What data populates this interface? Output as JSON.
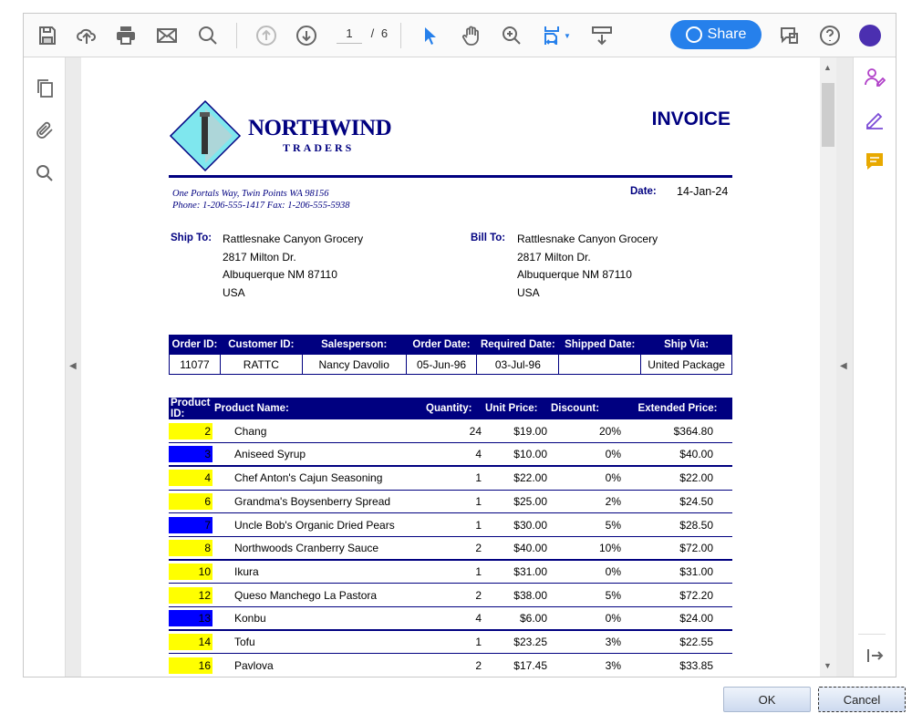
{
  "toolbar": {
    "page_current": "1",
    "page_sep": "/",
    "page_total": "6",
    "share_label": "Share"
  },
  "invoice": {
    "company_line1": "NORTHWIND",
    "company_line2": "TRADERS",
    "title": "INVOICE",
    "address": "One Portals Way, Twin Points WA  98156",
    "phone": "Phone: 1-206-555-1417   Fax: 1-206-555-5938",
    "date_label": "Date:",
    "date_value": "14-Jan-24",
    "ship_to_label": "Ship To:",
    "bill_to_label": "Bill To:",
    "ship_to": [
      "Rattlesnake Canyon Grocery",
      "2817 Milton Dr.",
      "Albuquerque NM  87110",
      "USA"
    ],
    "bill_to": [
      "Rattlesnake Canyon Grocery",
      "2817 Milton Dr.",
      "Albuquerque NM  87110",
      "USA"
    ],
    "order_headers": [
      "Order ID:",
      "Customer ID:",
      "Salesperson:",
      "Order Date:",
      "Required Date:",
      "Shipped Date:",
      "Ship Via:"
    ],
    "order_values": [
      "11077",
      "RATTC",
      "Nancy Davolio",
      "05-Jun-96",
      "03-Jul-96",
      "",
      "United Package"
    ],
    "product_headers": [
      "Product ID:",
      "Product Name:",
      "Quantity:",
      "Unit Price:",
      "Discount:",
      "Extended Price:"
    ],
    "products": [
      {
        "id": "2",
        "name": "Chang",
        "qty": "24",
        "price": "$19.00",
        "disc": "20%",
        "ext": "$364.80",
        "hl": "yellow"
      },
      {
        "id": "3",
        "name": "Aniseed Syrup",
        "qty": "4",
        "price": "$10.00",
        "disc": "0%",
        "ext": "$40.00",
        "hl": "blue"
      },
      {
        "id": "4",
        "name": "Chef Anton's Cajun Seasoning",
        "qty": "1",
        "price": "$22.00",
        "disc": "0%",
        "ext": "$22.00",
        "hl": "yellow"
      },
      {
        "id": "6",
        "name": "Grandma's Boysenberry Spread",
        "qty": "1",
        "price": "$25.00",
        "disc": "2%",
        "ext": "$24.50",
        "hl": "yellow"
      },
      {
        "id": "7",
        "name": "Uncle Bob's Organic Dried Pears",
        "qty": "1",
        "price": "$30.00",
        "disc": "5%",
        "ext": "$28.50",
        "hl": "blue"
      },
      {
        "id": "8",
        "name": "Northwoods Cranberry Sauce",
        "qty": "2",
        "price": "$40.00",
        "disc": "10%",
        "ext": "$72.00",
        "hl": "yellow"
      },
      {
        "id": "10",
        "name": "Ikura",
        "qty": "1",
        "price": "$31.00",
        "disc": "0%",
        "ext": "$31.00",
        "hl": "yellow"
      },
      {
        "id": "12",
        "name": "Queso Manchego La Pastora",
        "qty": "2",
        "price": "$38.00",
        "disc": "5%",
        "ext": "$72.20",
        "hl": "yellow"
      },
      {
        "id": "13",
        "name": "Konbu",
        "qty": "4",
        "price": "$6.00",
        "disc": "0%",
        "ext": "$24.00",
        "hl": "blue"
      },
      {
        "id": "14",
        "name": "Tofu",
        "qty": "1",
        "price": "$23.25",
        "disc": "3%",
        "ext": "$22.55",
        "hl": "yellow"
      },
      {
        "id": "16",
        "name": "Pavlova",
        "qty": "2",
        "price": "$17.45",
        "disc": "3%",
        "ext": "$33.85",
        "hl": "yellow"
      }
    ]
  },
  "dialog": {
    "ok_label": "OK",
    "cancel_label": "Cancel"
  },
  "colors": {
    "accent": "#2680eb",
    "navy": "#000080",
    "highlight_yellow": "#ffff00",
    "highlight_blue": "#0000ff"
  }
}
